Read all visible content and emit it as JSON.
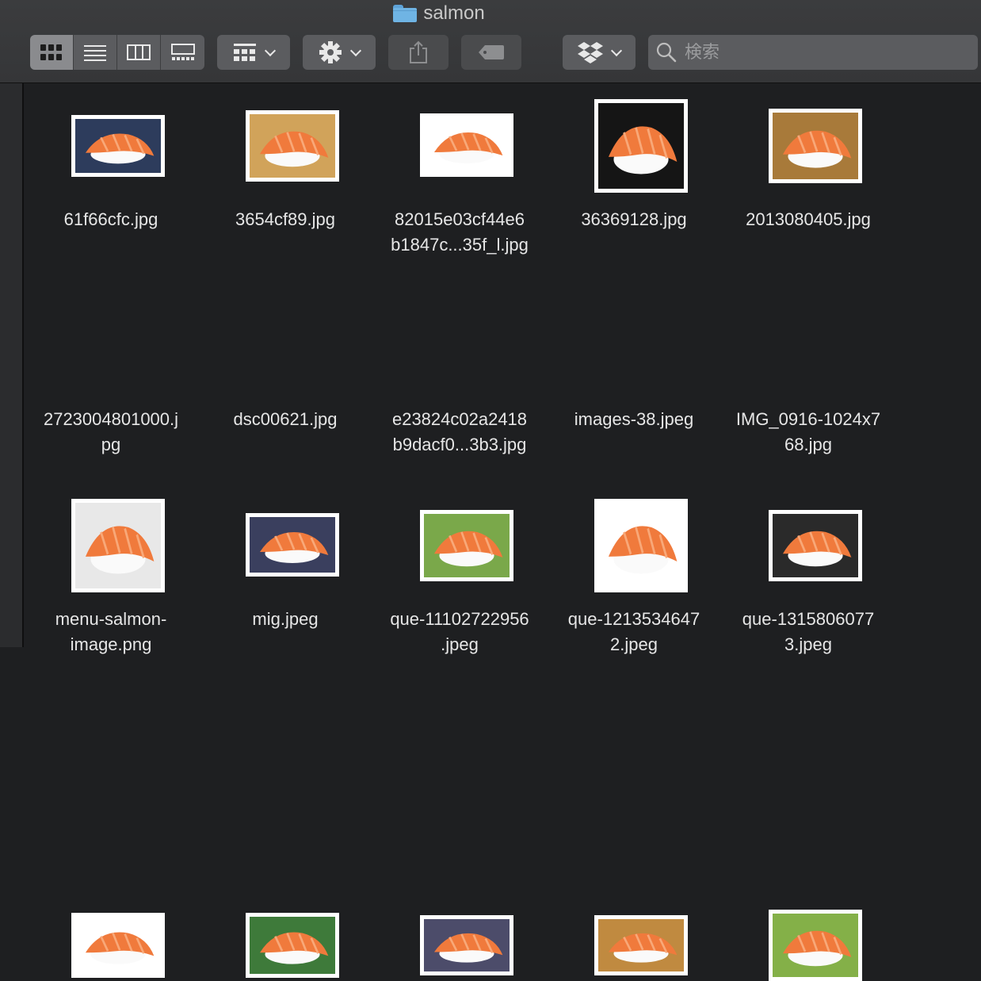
{
  "window": {
    "title": "salmon"
  },
  "toolbar": {
    "view_modes": [
      "icon",
      "list",
      "column",
      "gallery"
    ],
    "active_view": "icon",
    "group_button": "group-icon",
    "action_button": "gear-icon",
    "share_button": "share-icon",
    "tag_button": "tag-icon",
    "dropbox_button": "dropbox-icon"
  },
  "search": {
    "placeholder": "検索",
    "value": ""
  },
  "files": [
    {
      "name": "61f66cfc.jpg",
      "bg": "#2d3c5c"
    },
    {
      "name": "3654cf89.jpg",
      "bg": "#d1a35a"
    },
    {
      "name": "82015e03cf44e6\nb1847c...35f_l.jpg",
      "bg": "#ffffff"
    },
    {
      "name": "36369128.jpg",
      "bg": "#151515"
    },
    {
      "name": "2013080405.jpg",
      "bg": "#a87a3a"
    },
    {
      "name": "2723004801000.j\npg",
      "bg": "#e8e8e8"
    },
    {
      "name": "dsc00621.jpg",
      "bg": "#3a3f5e"
    },
    {
      "name": "e23824c02a2418\nb9dacf0...3b3.jpg",
      "bg": "#7aa84a"
    },
    {
      "name": "images-38.jpeg",
      "bg": "#ffffff"
    },
    {
      "name": "IMG_0916-1024x7\n68.jpg",
      "bg": "#2a2a2a"
    },
    {
      "name": "menu-salmon-\nimage.png",
      "bg": "#ffffff"
    },
    {
      "name": "mig.jpeg",
      "bg": "#3e7a3a"
    },
    {
      "name": "que-11102722956\n.jpeg",
      "bg": "#4c4c6a"
    },
    {
      "name": "que-1213534647\n2.jpeg",
      "bg": "#c08a40"
    },
    {
      "name": "que-1315806077\n3.jpeg",
      "bg": "#84b048"
    }
  ],
  "colors": {
    "salmon": "#f07a3c",
    "salmon_light": "#f8a878",
    "rice": "#fafafa",
    "accent_folder": "#6fb4e4"
  }
}
